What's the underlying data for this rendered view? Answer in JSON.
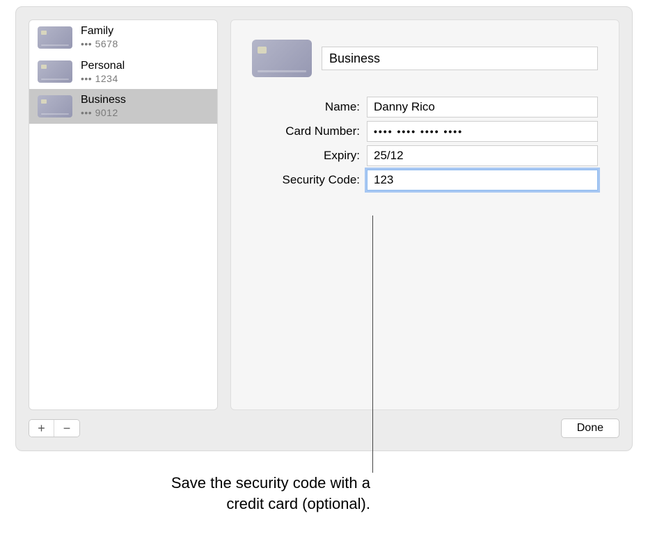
{
  "sidebar": {
    "items": [
      {
        "label": "Family",
        "masked": "••• 5678",
        "selected": false
      },
      {
        "label": "Personal",
        "masked": "••• 1234",
        "selected": false
      },
      {
        "label": "Business",
        "masked": "••• 9012",
        "selected": true
      }
    ]
  },
  "controls": {
    "add": "+",
    "remove": "−"
  },
  "detail": {
    "title_value": "Business",
    "fields": {
      "name": {
        "label": "Name:",
        "value": "Danny Rico"
      },
      "card_number": {
        "label": "Card Number:",
        "value": "•••• •••• •••• ••••"
      },
      "expiry": {
        "label": "Expiry:",
        "value": "25/12"
      },
      "security": {
        "label": "Security Code:",
        "value": "123"
      }
    }
  },
  "footer": {
    "done": "Done"
  },
  "callout": {
    "line1": "Save the security code with a",
    "line2": "credit card (optional)."
  }
}
